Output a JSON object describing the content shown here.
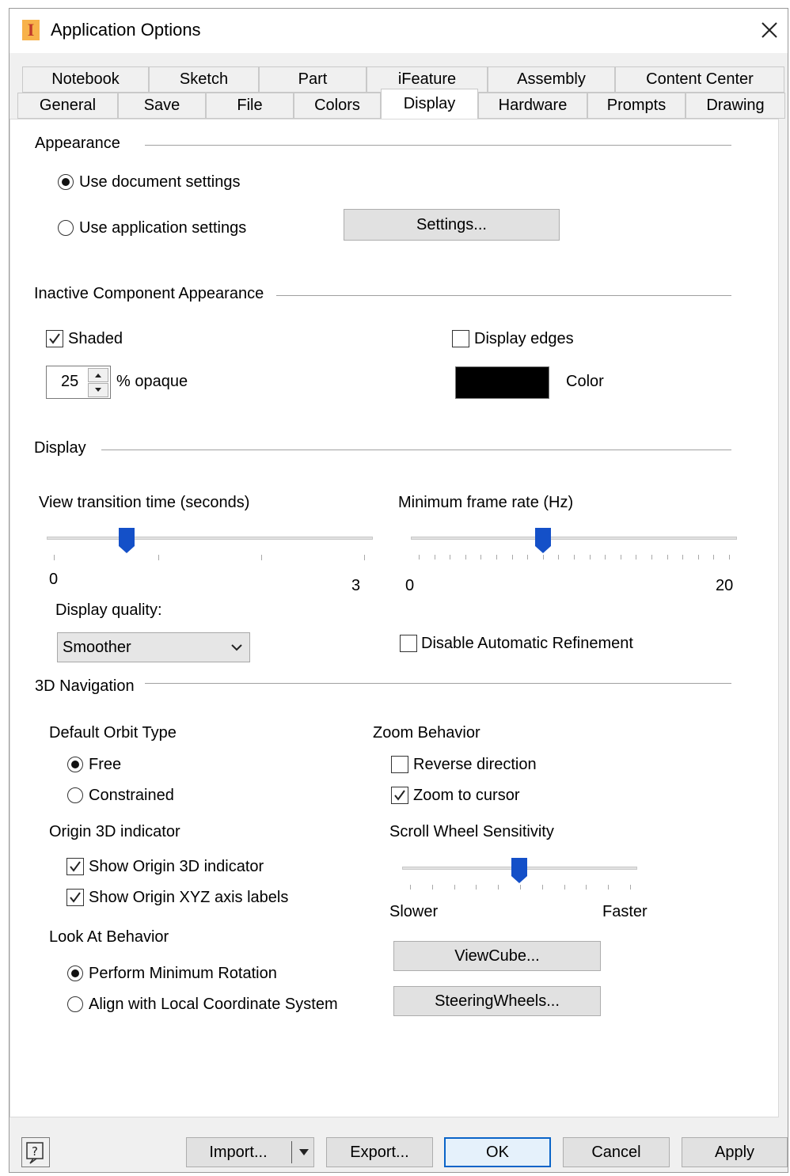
{
  "window": {
    "title": "Application Options",
    "app_icon_glyph": "I"
  },
  "tabs_row1": [
    "Notebook",
    "Sketch",
    "Part",
    "iFeature",
    "Assembly",
    "Content Center"
  ],
  "tabs_row2": [
    "General",
    "Save",
    "File",
    "Colors",
    "Display",
    "Hardware",
    "Prompts",
    "Drawing"
  ],
  "active_tab": "Display",
  "appearance": {
    "heading": "Appearance",
    "use_document": "Use document settings",
    "use_application": "Use application settings",
    "selected": "Use document settings",
    "settings_button": "Settings..."
  },
  "inactive": {
    "heading": "Inactive Component Appearance",
    "shaded": "Shaded",
    "shaded_checked": true,
    "opacity_value": "25",
    "opaque_label": "% opaque",
    "display_edges": "Display edges",
    "display_edges_checked": false,
    "color_label": "Color",
    "color_value": "#000000"
  },
  "display": {
    "heading": "Display",
    "view_transition_label": "View transition time (seconds)",
    "view_transition_min": "0",
    "view_transition_max": "3",
    "view_transition_fraction": 0.24,
    "min_frame_label": "Minimum frame rate (Hz)",
    "min_frame_min": "0",
    "min_frame_max": "20",
    "min_frame_fraction": 0.4,
    "quality_label": "Display quality:",
    "quality_value": "Smoother",
    "disable_refinement": "Disable Automatic Refinement",
    "disable_refinement_checked": false
  },
  "nav": {
    "heading": "3D Navigation",
    "orbit_heading": "Default Orbit Type",
    "orbit_free": "Free",
    "orbit_constrained": "Constrained",
    "orbit_selected": "Free",
    "origin_heading": "Origin 3D indicator",
    "show_origin": "Show Origin 3D indicator",
    "show_origin_checked": true,
    "show_xyz": "Show Origin XYZ axis labels",
    "show_xyz_checked": true,
    "lookat_heading": "Look At Behavior",
    "min_rotation": "Perform Minimum Rotation",
    "align_local": "Align with Local Coordinate System",
    "lookat_selected": "Perform Minimum Rotation",
    "zoom_heading": "Zoom Behavior",
    "reverse_direction": "Reverse direction",
    "reverse_checked": false,
    "zoom_to_cursor": "Zoom to cursor",
    "zoom_to_cursor_checked": true,
    "scroll_heading": "Scroll Wheel Sensitivity",
    "scroll_slower": "Slower",
    "scroll_faster": "Faster",
    "scroll_fraction": 0.5,
    "viewcube_button": "ViewCube...",
    "steeringwheels_button": "SteeringWheels..."
  },
  "footer": {
    "help_glyph": "?",
    "import": "Import...",
    "export": "Export...",
    "ok": "OK",
    "cancel": "Cancel",
    "apply": "Apply"
  },
  "colors": {
    "accent": "#1450c8",
    "default_button_border": "#0a64c8",
    "panel": "#ffffff",
    "chrome": "#f0f0f0"
  }
}
